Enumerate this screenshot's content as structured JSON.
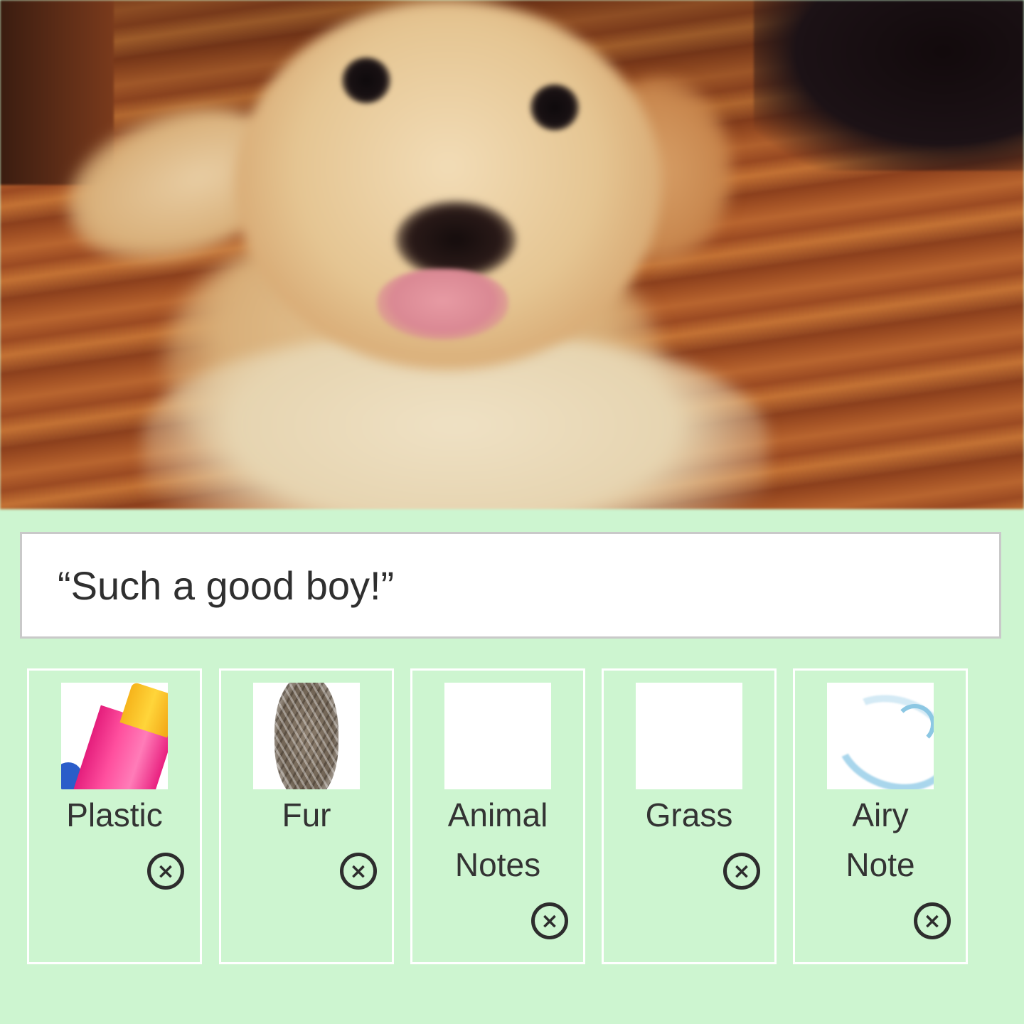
{
  "photo": {
    "subject": "puppy-photo"
  },
  "caption": {
    "value": "“Such a good boy!”"
  },
  "tags": [
    {
      "label": "Plastic",
      "icon": "plastic-bottle-thumbnail",
      "remove_icon": "⨯"
    },
    {
      "label": "Fur",
      "icon": "fur-thumbnail",
      "remove_icon": "⨯"
    },
    {
      "label_line1": "Animal",
      "label_line2": "Notes",
      "icon": "animal-print-thumbnail",
      "remove_icon": "⨯"
    },
    {
      "label": "Grass",
      "icon": "grass-thumbnail",
      "remove_icon": "⨯"
    },
    {
      "label_line1": "Airy",
      "label_line2": "Note",
      "icon": "air-swirl-thumbnail",
      "remove_icon": "⨯"
    }
  ],
  "colors": {
    "background": "#cdf5d0",
    "card_border": "#ffffff",
    "text": "#333333",
    "caption_border": "#c9c9c9"
  }
}
